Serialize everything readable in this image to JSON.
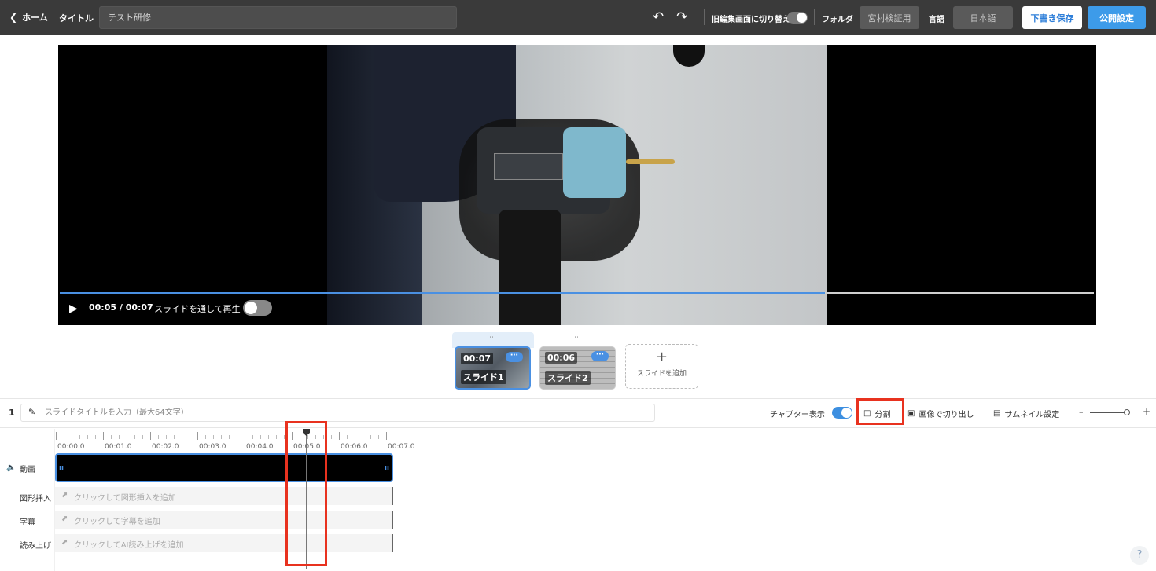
{
  "topbar": {
    "back_label": "ホーム",
    "title_label": "タイトル",
    "title_value": "テスト研修",
    "old_editor_label": "旧編集画面に切り替え",
    "folder_label": "フォルダ",
    "folder_value": "宮村検証用",
    "language_label": "言語",
    "language_value": "日本語",
    "draft_button": "下書き保存",
    "publish_button": "公開設定"
  },
  "player": {
    "current_time": "00:05 / 00:07",
    "slide_play_label": "スライドを通して再生",
    "progress": 0.74
  },
  "slides": [
    {
      "duration": "00:07",
      "name": "スライド1",
      "selected": true
    },
    {
      "duration": "00:06",
      "name": "スライド2",
      "selected": false
    }
  ],
  "add_slide_label": "スライドを追加",
  "editor": {
    "slide_number": "1",
    "slide_title_placeholder": "スライドタイトルを入力（最大64文字）",
    "chapter_label": "チャプター表示",
    "split_label": "分割",
    "crop_image_label": "画像で切り出し",
    "thumbnail_label": "サムネイル設定"
  },
  "timeline": {
    "ticks": [
      "00:00.0",
      "00:01.0",
      "00:02.0",
      "00:03.0",
      "00:04.0",
      "00:05.0",
      "00:06.0",
      "00:07.0"
    ],
    "tracks": {
      "video": "動画",
      "shape": "図形挿入",
      "subtitle": "字幕",
      "narration": "読み上げ"
    },
    "hints": {
      "shape": "クリックして図形挿入を追加",
      "subtitle": "クリックして字幕を追加",
      "narration": "クリックしてAI読み上げを追加"
    },
    "playhead_time_seconds": 5.3
  },
  "help_label": "?",
  "colors": {
    "accent": "#4a90e2",
    "highlight": "#e8321f",
    "topbar": "#3a3a3a"
  }
}
